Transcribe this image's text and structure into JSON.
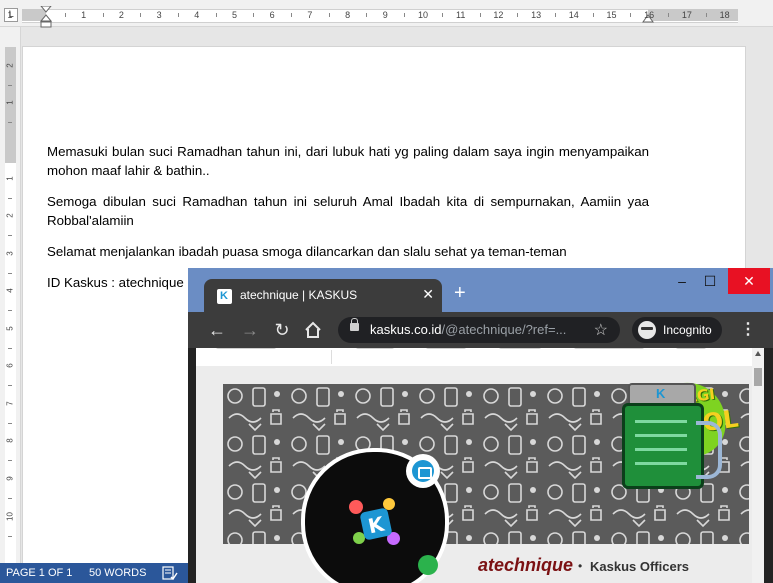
{
  "word": {
    "ruler_h_numbers": [
      "1",
      "1",
      "2",
      "3",
      "4",
      "5",
      "6",
      "7",
      "8",
      "9",
      "10",
      "11",
      "12",
      "13",
      "14",
      "15",
      "16",
      "17",
      "18"
    ],
    "ruler_v_numbers": [
      "2",
      "1",
      "1",
      "2",
      "3",
      "4",
      "5",
      "6",
      "7",
      "8",
      "9",
      "10"
    ],
    "corner_tab_glyph": "L",
    "document": {
      "paragraphs": [
        "Memasuki bulan suci Ramadhan tahun ini, dari lubuk hati yg paling dalam saya ingin menyampaikan mohon maaf lahir & bathin..",
        "Semoga dibulan suci Ramadhan tahun ini seluruh Amal Ibadah kita di sempurnakan, Aamiin yaa Robbal'alamiin",
        "Selamat menjalankan ibadah puasa smoga dilancarkan dan slalu sehat ya teman-teman",
        "ID Kaskus : atechnique"
      ]
    },
    "status_bar": {
      "page": "PAGE 1 OF 1",
      "words": "50 WORDS"
    },
    "colors": {
      "status_bar": "#2b579a"
    }
  },
  "browser": {
    "tab_title": "atechnique | KASKUS",
    "new_tab_glyph": "+",
    "url_host": "kaskus.co.id",
    "url_path": "/@atechnique/?ref=...",
    "incognito_label": "Incognito",
    "window_controls": {
      "minimize": "–",
      "maximize": "☐",
      "close": "✕"
    },
    "colors": {
      "titlebar": "#6b8dc4",
      "close": "#e81123",
      "toolbar": "#3c3c3c"
    }
  },
  "kaskus_profile": {
    "username": "atechnique",
    "separator": "•",
    "role": "Kaskus Officers",
    "promo_line1": "BERBAGI",
    "promo_line2": "CENDOL",
    "colors": {
      "username": "#7b1113",
      "brand": "#1d96d3",
      "online": "#2bb24c",
      "promo": "#7ed321"
    }
  }
}
